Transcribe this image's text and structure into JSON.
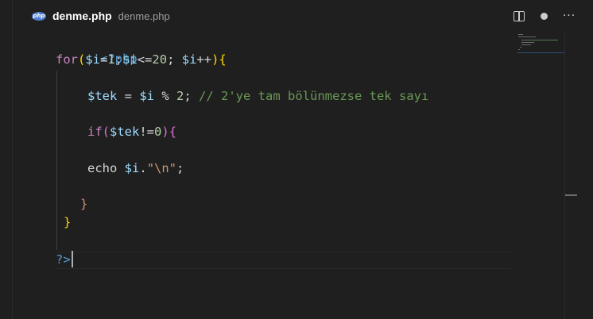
{
  "tab": {
    "file_icon_text": "php",
    "file_name": "denme.php",
    "description": "denme.php"
  },
  "actions": {
    "split_editor": "split-editor-icon",
    "unsaved": "unsaved-dot-icon",
    "more": "ellipsis-icon"
  },
  "colors": {
    "background": "#1f1f1f",
    "keyword": "#c586c0",
    "variable": "#9cdcfe",
    "number": "#b5cea8",
    "string": "#ce9178",
    "comment": "#6a9955",
    "php_tag": "#569cd6"
  },
  "code": {
    "l1": {
      "open": "<?php"
    },
    "l2": {
      "kw": "for",
      "p1": "(",
      "v1": "$i",
      "t1": "=",
      "n1": "1",
      "t2": ";",
      "v2": "$i",
      "t3": "<=",
      "n2": "20",
      "t4": "; ",
      "v3": "$i",
      "t5": "++",
      "p2": ")",
      "p3": "{"
    },
    "l3": {
      "v1": "$tek",
      "t1": " = ",
      "v2": "$i",
      "t2": " % ",
      "n1": "2",
      "t3": "; ",
      "c1": "// 2'ye tam bölünmezse tek sayı"
    },
    "l4": {
      "kw": "if",
      "p1": "(",
      "v1": "$tek",
      "t1": "!=",
      "n1": "0",
      "p2": ")",
      "p3": "{"
    },
    "l5": {
      "kw": "echo",
      "t1": " ",
      "v1": "$i",
      "t2": ".",
      "s1": "\"\\n\"",
      "t3": ";"
    },
    "l6": {
      "p1": "}"
    },
    "l7": {
      "p1": "}"
    },
    "l8": {
      "close": "?>"
    }
  }
}
